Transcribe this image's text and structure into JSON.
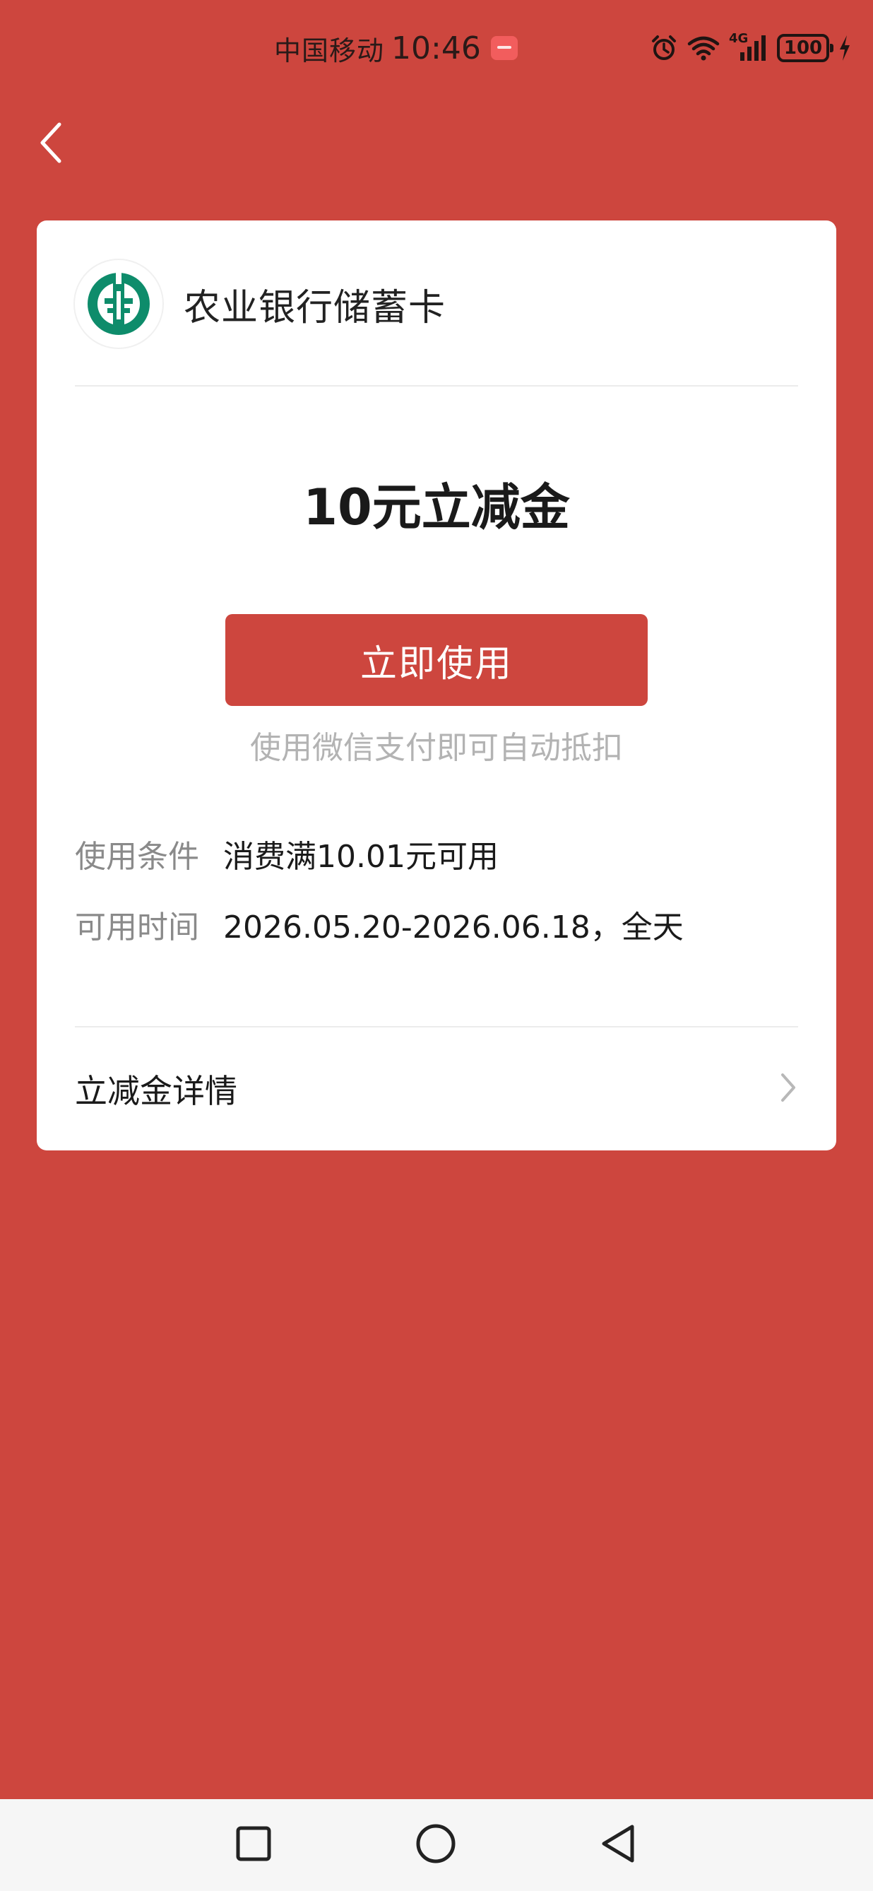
{
  "status_bar": {
    "carrier": "中国移动",
    "time": "10:46",
    "network": "4G",
    "battery": "100"
  },
  "card": {
    "bank_name": "农业银行储蓄卡",
    "coupon_title": "10元立减金",
    "use_button_label": "立即使用",
    "use_hint": "使用微信支付即可自动抵扣",
    "conditions_label": "使用条件",
    "conditions_value": "消费满10.01元可用",
    "time_label": "可用时间",
    "time_value": "2026.05.20-2026.06.18，全天",
    "details_label": "立减金详情"
  },
  "icons": {
    "back": "chevron-left-icon",
    "details_arrow": "chevron-right-icon",
    "logo": "abc-bank-logo-icon",
    "nav_recent": "square-icon",
    "nav_home": "circle-icon",
    "nav_back": "triangle-icon"
  },
  "colors": {
    "background": "#CD463E",
    "accent": "#CD463E",
    "logo_green": "#0E8C6B",
    "card": "#FFFFFF"
  }
}
